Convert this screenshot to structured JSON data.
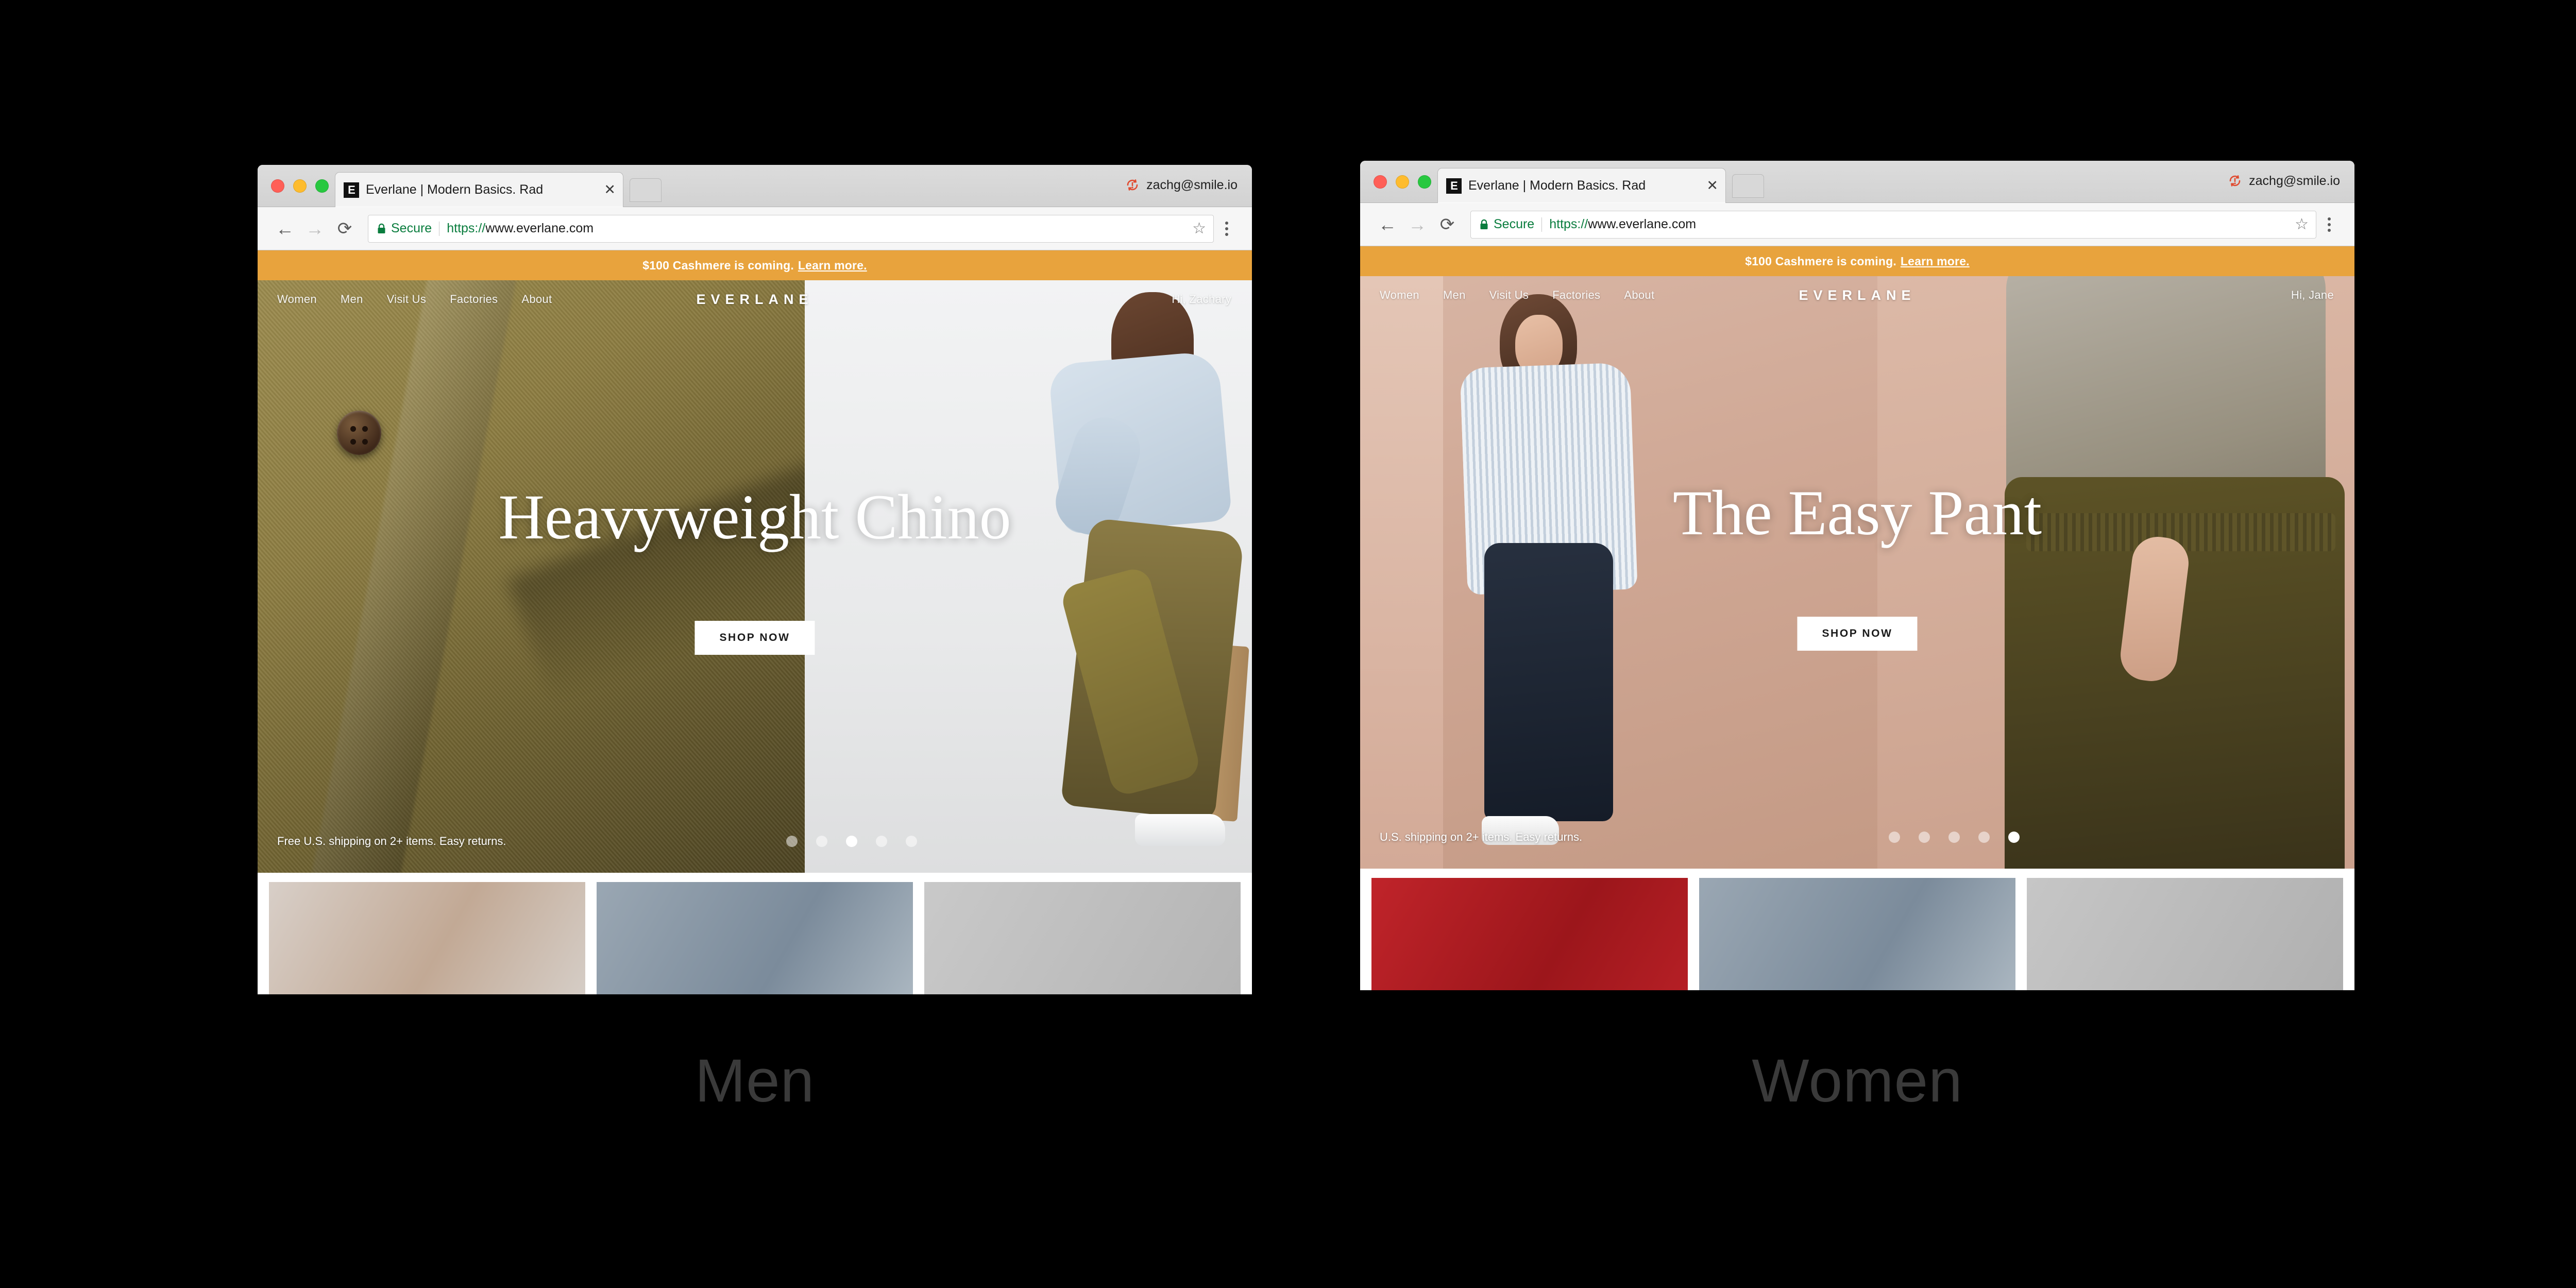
{
  "windows": [
    {
      "id": "men",
      "caption": "Men",
      "browser": {
        "tab_title": "Everlane | Modern Basics. Rad",
        "tab_close_icon": "close-icon",
        "favicon_letter": "E",
        "profile_name": "zachg@smile.io",
        "sync_icon": "sync-error-icon",
        "back_icon": "←",
        "forward_icon": "→",
        "reload_icon": "⟳",
        "security_label": "Secure",
        "url_scheme": "https://",
        "url_rest": "www.everlane.com",
        "lock_icon": "lock-icon",
        "star_icon": "★",
        "menu_icon": "kebab-menu-icon"
      },
      "site": {
        "promo_text": "$100 Cashmere is coming.",
        "promo_link": "Learn more.",
        "nav_items": [
          "Women",
          "Men",
          "Visit Us",
          "Factories",
          "About"
        ],
        "brand": "EVERLANE",
        "greeting": "Hi, Zachary",
        "hero_title": "Heavyweight Chino",
        "cta_label": "SHOP NOW",
        "shipping_note": "Free U.S. shipping on 2+ items. Easy returns.",
        "carousel_dots": 5,
        "carousel_active_index": 2
      }
    },
    {
      "id": "women",
      "caption": "Women",
      "browser": {
        "tab_title": "Everlane | Modern Basics. Rad",
        "tab_close_icon": "close-icon",
        "favicon_letter": "E",
        "profile_name": "zachg@smile.io",
        "sync_icon": "sync-error-icon",
        "back_icon": "←",
        "forward_icon": "→",
        "reload_icon": "⟳",
        "security_label": "Secure",
        "url_scheme": "https://",
        "url_rest": "www.everlane.com",
        "lock_icon": "lock-icon",
        "star_icon": "★",
        "menu_icon": "kebab-menu-icon"
      },
      "site": {
        "promo_text": "$100 Cashmere is coming.",
        "promo_link": "Learn more.",
        "nav_items": [
          "Women",
          "Men",
          "Visit Us",
          "Factories",
          "About"
        ],
        "brand": "EVERLANE",
        "greeting": "Hi, Jane",
        "hero_title": "The Easy Pant",
        "cta_label": "SHOP NOW",
        "shipping_note": "U.S. shipping on 2+ items. Easy returns.",
        "carousel_dots": 5,
        "carousel_active_index": 4
      }
    }
  ],
  "colors": {
    "promo_bar": "#e8a33d",
    "secure_green": "#0a7d3e",
    "page_background": "#000000",
    "caption_text": "#3a3a3a"
  },
  "tiles": {
    "men": [
      "#d6cdc6",
      "#8d9aa6",
      "#c3c3c3"
    ],
    "women": [
      "#b61d22",
      "#8d9aa6",
      "#bdbdbd"
    ]
  }
}
